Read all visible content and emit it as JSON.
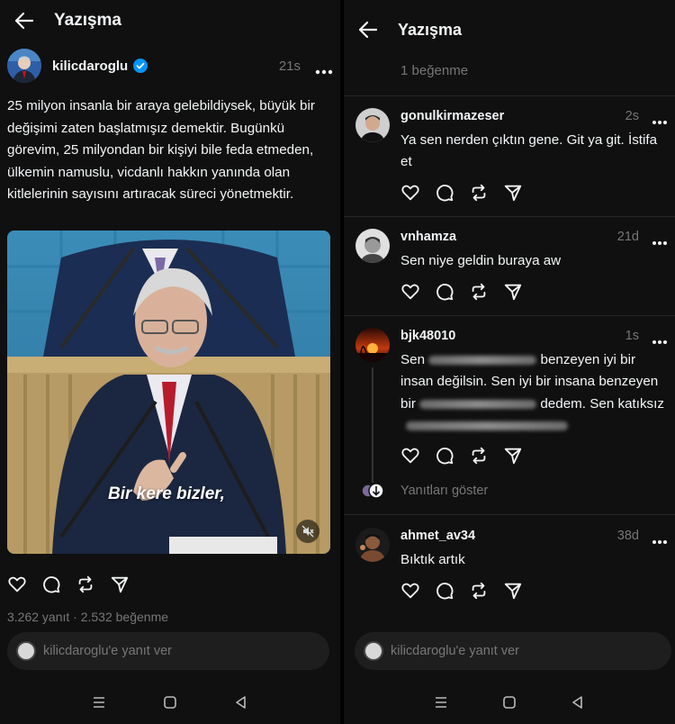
{
  "left": {
    "header_title": "Yazışma",
    "post": {
      "username": "kilicdaroglu",
      "time": "21s",
      "text": "25 milyon insanla bir araya gelebildiysek, büyük bir değişimi zaten başlatmışız demektir. Bugünkü görevim, 25 milyondan bir kişiyi bile feda etmeden, ülkemin namuslu, vicdanlı hakkın yanında olan kitlelerinin sayısını artıracak süreci yönetmektir.",
      "video_caption": "Bir kere bizler,",
      "stats": "3.262 yanıt · 2.532 beğenme"
    },
    "reply_placeholder": "kilicdaroglu'e yanıt ver"
  },
  "right": {
    "header_title": "Yazışma",
    "likes_top": "1 beğenme",
    "replies": [
      {
        "username": "gonulkirmazeser",
        "time": "2s",
        "text": "Ya sen nerden çıktın gene. Git ya git. İstifa et"
      },
      {
        "username": "vnhamza",
        "time": "21d",
        "text": "Sen niye geldin buraya aw"
      },
      {
        "username": "bjk48010",
        "time": "1s",
        "line1_a": "Sen",
        "line1_b": "benzeyen iyi bir",
        "line2": "insan değilsin. Sen iyi bir insana benzeyen",
        "line3_a": "bir",
        "line3_b": "dedem. Sen katıksız"
      },
      {
        "username": "ahmet_av34",
        "time": "38d",
        "text": "Bıktık artık"
      }
    ],
    "show_replies": "Yanıtları göster",
    "reply_placeholder": "kilicdaroglu'e yanıt ver"
  },
  "colors": {
    "background": "#101010",
    "text": "#f3f5f7",
    "muted": "#777777",
    "verified": "#0095f6",
    "separator": "#262626"
  },
  "icons": [
    "back-arrow-icon",
    "verified-badge-icon",
    "more-icon",
    "heart-icon",
    "comment-icon",
    "repost-icon",
    "share-icon",
    "mute-icon",
    "nav-menu-icon",
    "nav-home-icon",
    "nav-back-icon"
  ]
}
